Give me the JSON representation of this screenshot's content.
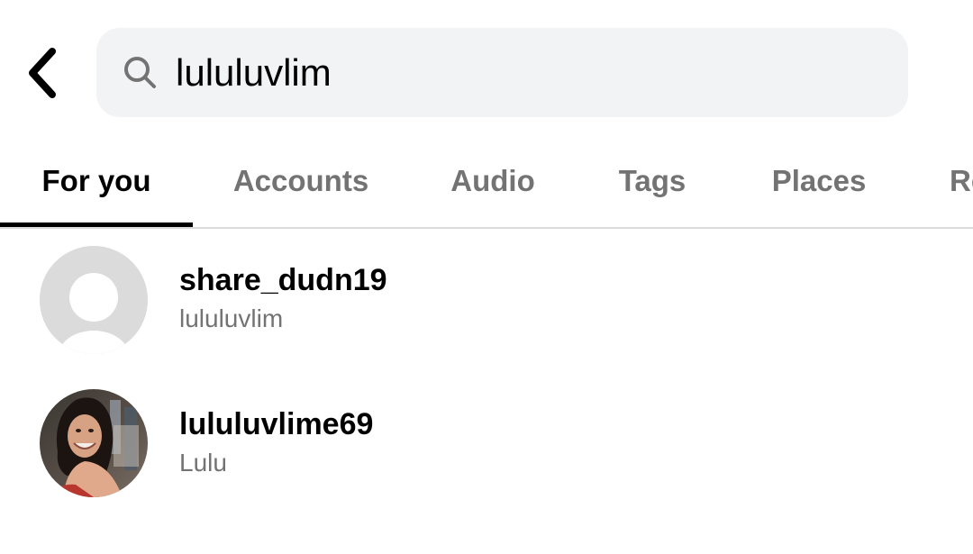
{
  "header": {
    "back_icon": "chevron-left-icon",
    "search": {
      "icon": "search-icon",
      "value": "lululuvlim",
      "background": "#f2f3f5"
    }
  },
  "tabs": [
    {
      "label": "For you",
      "active": true
    },
    {
      "label": "Accounts",
      "active": false
    },
    {
      "label": "Audio",
      "active": false
    },
    {
      "label": "Tags",
      "active": false
    },
    {
      "label": "Places",
      "active": false
    },
    {
      "label": "Re",
      "active": false
    }
  ],
  "results": [
    {
      "username": "share_dudn19",
      "full_name": "lululuvlim",
      "avatar": "default-avatar"
    },
    {
      "username": "lululuvlime69",
      "full_name": "Lulu",
      "avatar": "profile-photo"
    }
  ],
  "colors": {
    "primary_text": "#000000",
    "secondary_text": "#737373",
    "divider": "#dbdbdb",
    "placeholder_avatar": "#dbdbdb"
  }
}
